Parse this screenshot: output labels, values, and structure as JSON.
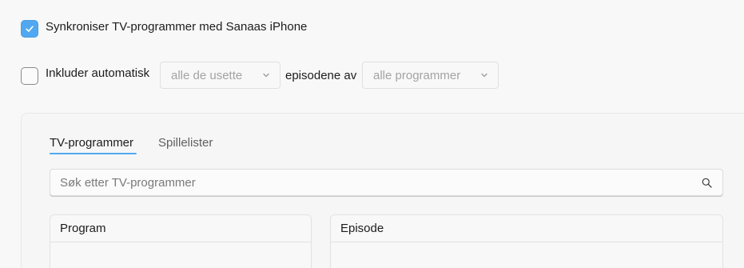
{
  "sync": {
    "checked": true,
    "label": "Synkroniser TV-programmer med Sanaas iPhone"
  },
  "include": {
    "checked": false,
    "label": "Inkluder automatisk",
    "episodes_select": "alle de usette",
    "middle_text": "episodene av",
    "programs_select": "alle programmer"
  },
  "tabs": [
    {
      "label": "TV-programmer",
      "active": true
    },
    {
      "label": "Spillelister",
      "active": false
    }
  ],
  "search": {
    "placeholder": "Søk etter TV-programmer",
    "value": ""
  },
  "columns": {
    "program_header": "Program",
    "episode_header": "Episode"
  },
  "colors": {
    "accent": "#52a8f0"
  },
  "icons": {
    "checkmark": "checkmark-icon",
    "chevron": "chevron-down-icon",
    "search": "search-icon"
  }
}
